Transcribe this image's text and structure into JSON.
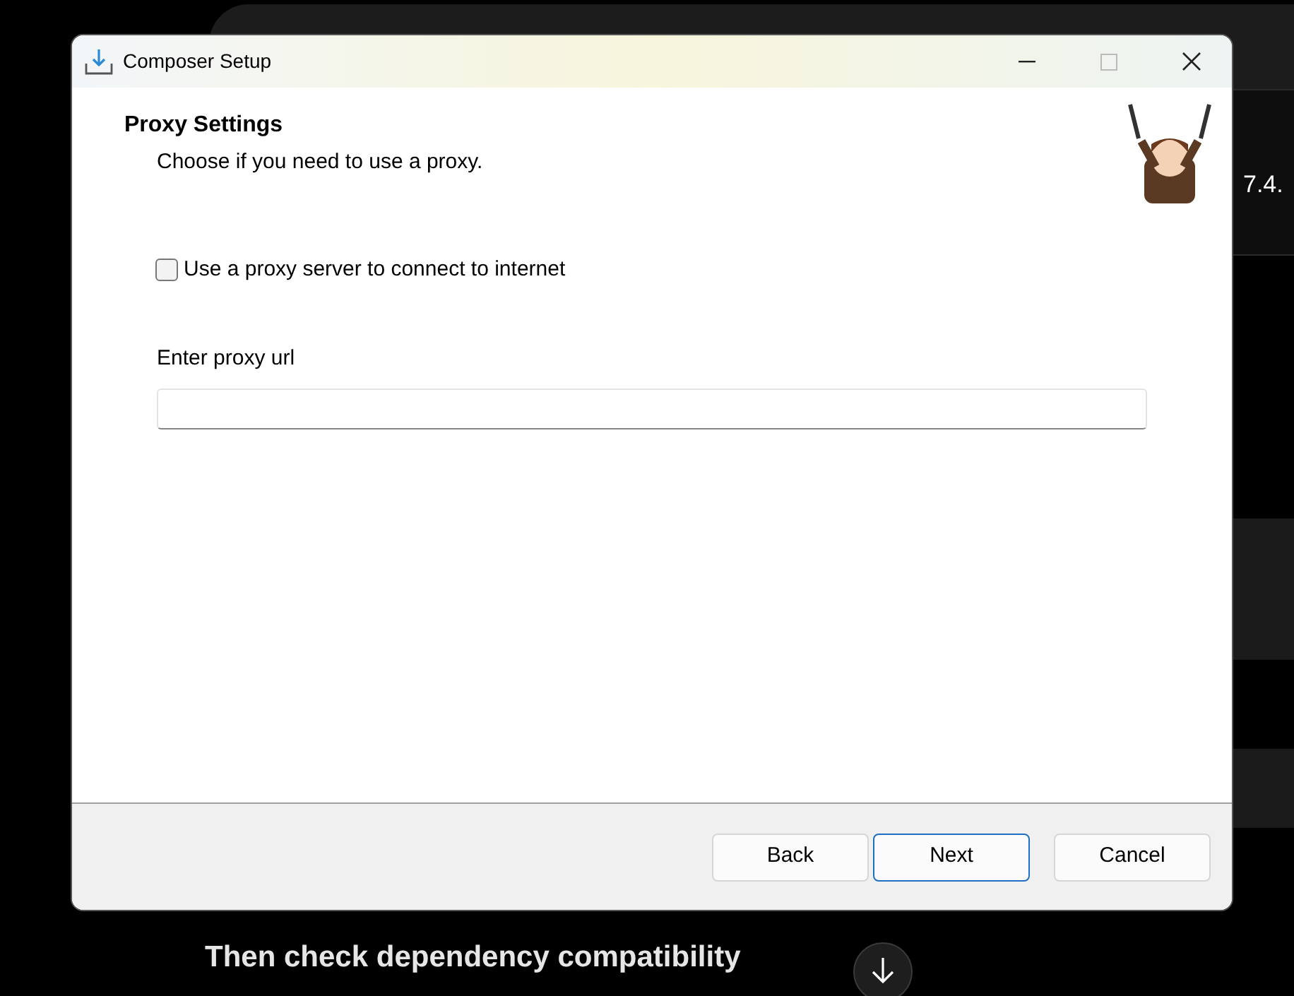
{
  "background": {
    "side_text": "7.4.",
    "caption": "Then check dependency compatibility"
  },
  "window": {
    "title": "Composer Setup"
  },
  "page": {
    "heading": "Proxy Settings",
    "subheading": "Choose if you need to use a proxy."
  },
  "proxy_checkbox": {
    "label": "Use a proxy server to connect to internet",
    "checked": false
  },
  "proxy_field": {
    "label": "Enter proxy url"
  },
  "buttons": [
    {
      "label": "Back",
      "focused": false
    },
    {
      "label": "Next",
      "focused": true
    },
    {
      "label": "Cancel",
      "focused": false
    }
  ]
}
